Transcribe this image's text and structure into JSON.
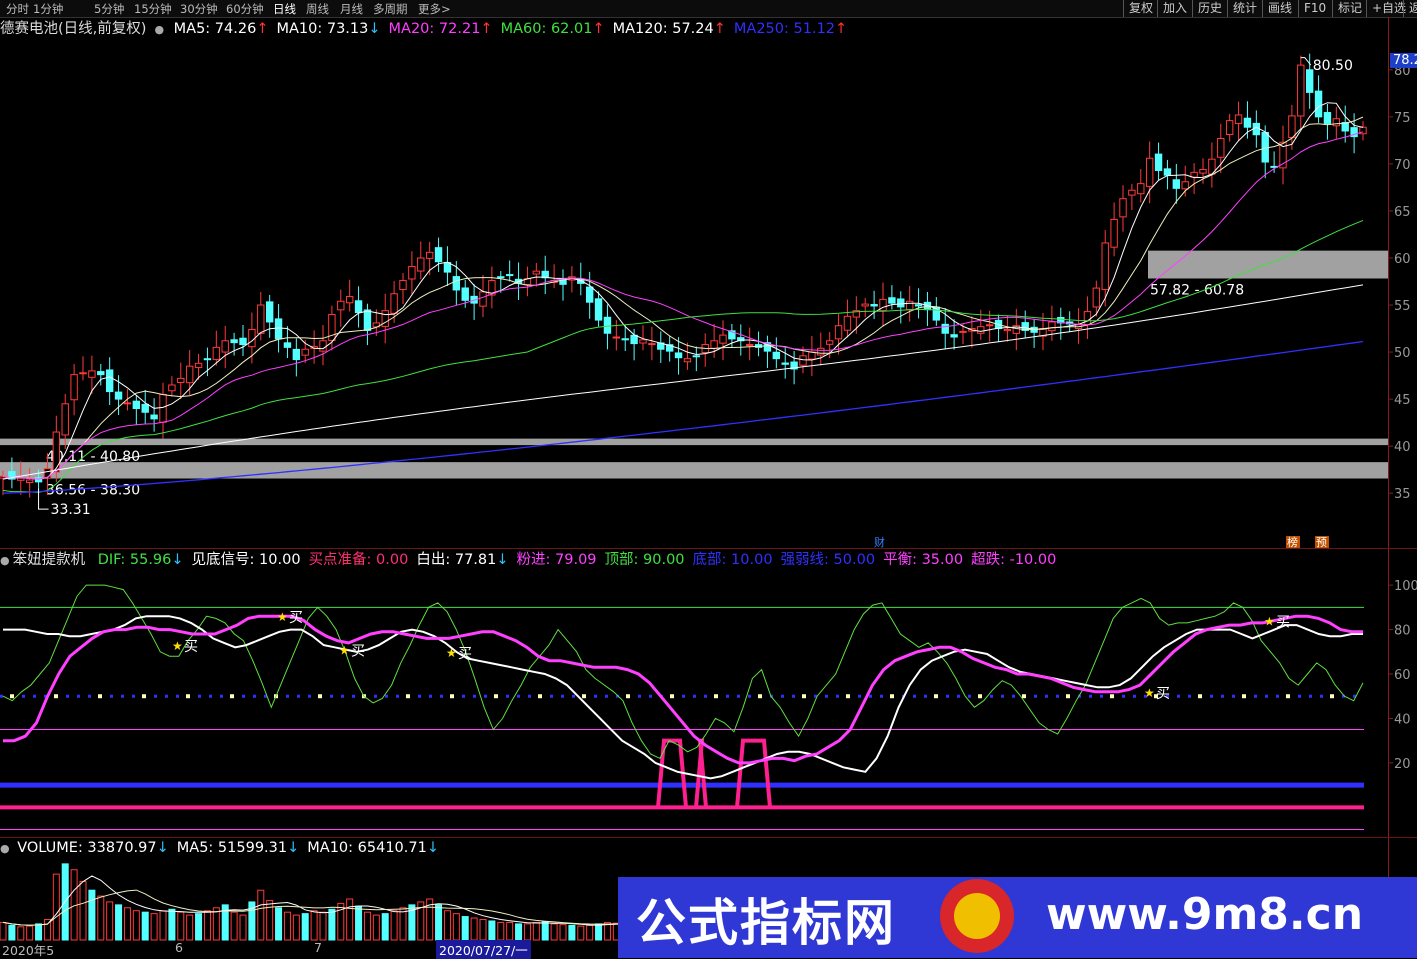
{
  "toolbar": {
    "periods": [
      "分时",
      "1分钟",
      "5分钟",
      "15分钟",
      "30分钟",
      "60分钟",
      "日线",
      "周线",
      "月线",
      "多周期",
      "更多>"
    ],
    "active_period": "日线",
    "right_buttons": [
      "复权",
      "加入",
      "历史",
      "统计",
      "画线",
      "F10",
      "标记",
      "+自选",
      "返"
    ]
  },
  "main_info": {
    "stock": "德赛电池(日线,前复权)",
    "ma": [
      {
        "label": "MA5: 74.26",
        "arrow": "↑",
        "color": "#ffffff"
      },
      {
        "label": "MA10: 73.13",
        "arrow": "↓",
        "color": "#ffffff"
      },
      {
        "label": "MA20: 72.21",
        "arrow": "↑",
        "color": "#ff40ff"
      },
      {
        "label": "MA60: 62.01",
        "arrow": "↑",
        "color": "#40e040"
      },
      {
        "label": "MA120: 57.24",
        "arrow": "↑",
        "color": "#ffffff"
      },
      {
        "label": "MA250: 51.12",
        "arrow": "↑",
        "color": "#3030ff"
      }
    ]
  },
  "indicator_info": {
    "name": "笨妞提款机",
    "items": [
      {
        "label": "DIF: 55.96",
        "arrow": "↓",
        "color": "#40e040"
      },
      {
        "label": "见底信号: 10.00",
        "arrow": "",
        "color": "#ffffff"
      },
      {
        "label": "买点准备: 0.00",
        "arrow": "",
        "color": "#ff3070"
      },
      {
        "label": "白出: 77.81",
        "arrow": "↓",
        "color": "#ffffff"
      },
      {
        "label": "粉进: 79.09",
        "arrow": "",
        "color": "#ff40ff"
      },
      {
        "label": "顶部: 90.00",
        "arrow": "",
        "color": "#40e040"
      },
      {
        "label": "底部: 10.00",
        "arrow": "",
        "color": "#3030ff"
      },
      {
        "label": "强弱线: 50.00",
        "arrow": "",
        "color": "#3030ff"
      },
      {
        "label": "平衡: 35.00",
        "arrow": "",
        "color": "#ff40ff"
      },
      {
        "label": "超跌: -10.00",
        "arrow": "",
        "color": "#ff40ff"
      }
    ]
  },
  "volume_info": {
    "items": [
      {
        "label": "VOLUME: 33870.97",
        "arrow": "↓",
        "color": "#ffffff"
      },
      {
        "label": "MA5: 51599.31",
        "arrow": "↓",
        "color": "#ffffff"
      },
      {
        "label": "MA10: 65410.71",
        "arrow": "↓",
        "color": "#ffffff"
      }
    ]
  },
  "chart_data": [
    {
      "type": "candlestick",
      "title": "德赛电池(日线,前复权)",
      "y_ticks": [
        "80",
        "75",
        "70",
        "65",
        "60",
        "55",
        "50",
        "45",
        "40",
        "35"
      ],
      "ylim": [
        33,
        82
      ],
      "current_price_tag": "78.2",
      "zones": [
        {
          "label": "57.82 - 60.78",
          "low": 57.82,
          "high": 60.78
        },
        {
          "label": "40.11 - 40.80",
          "low": 40.11,
          "high": 40.8
        },
        {
          "label": "36.56 - 38.30",
          "low": 36.56,
          "high": 38.3
        }
      ],
      "annotations": [
        {
          "text": "80.50",
          "value": 80.5
        },
        {
          "text": "33.31",
          "value": 33.31
        }
      ],
      "event_markers": [
        "财",
        "榜",
        "预"
      ],
      "close_path": [
        36.8,
        36.5,
        36.6,
        36.4,
        36.2,
        37.6,
        41.5,
        44.5,
        47.6,
        47.8,
        48.0,
        47.6,
        45.8,
        45.0,
        44.6,
        44.0,
        43.6,
        42.9,
        45.5,
        46.5,
        47.2,
        48.5,
        48.8,
        49.2,
        50.5,
        51.2,
        51.0,
        50.8,
        52.4,
        55.0,
        53.2,
        51.4,
        50.5,
        49.2,
        50.3,
        50.6,
        51.2,
        54.0,
        55.4,
        55.9,
        54.2,
        52.3,
        53.1,
        54.4,
        56.2,
        57.6,
        59.1,
        60.0,
        60.6,
        59.6,
        58.5,
        56.6,
        55.5,
        55.2,
        56.4,
        57.6,
        58.0,
        58.2,
        57.3,
        57.8,
        58.6,
        57.9,
        57.6,
        57.2,
        58.0,
        57.3,
        55.3,
        53.4,
        52.0,
        51.6,
        51.3,
        50.9,
        51.3,
        50.9,
        50.3,
        50.1,
        49.4,
        49.3,
        49.6,
        50.8,
        51.2,
        51.8,
        51.4,
        51.2,
        50.8,
        50.5,
        50.1,
        49.3,
        48.7,
        48.2,
        49.6,
        50.0,
        50.4,
        51.2,
        52.8,
        53.8,
        54.4,
        55.1,
        54.9,
        55.6,
        55.2,
        54.8,
        55.4,
        54.9,
        54.5,
        53.4,
        52.0,
        51.6,
        52.2,
        52.5,
        52.7,
        52.9,
        52.5,
        52.4,
        52.8,
        52.3,
        52.1,
        52.5,
        53.2,
        53.1,
        53.0,
        52.9,
        54.3,
        56.8,
        61.6,
        64.1,
        66.3,
        67.2,
        67.9,
        70.6,
        69.3,
        68.8,
        67.4,
        68.1,
        69.1,
        69.4,
        70.5,
        72.7,
        74.6,
        75.2,
        73.9,
        73.1,
        70.2,
        69.7,
        72.3,
        75.1,
        80.5,
        77.6,
        75.0,
        74.3,
        74.8,
        73.5,
        72.9,
        73.9
      ],
      "ma_series": [
        {
          "name": "MA5",
          "last": 74.26,
          "color": "#ffffff"
        },
        {
          "name": "MA10",
          "last": 73.13,
          "color": "#ffffff"
        },
        {
          "name": "MA20",
          "last": 72.21,
          "color": "#ff40ff"
        },
        {
          "name": "MA60",
          "last": 62.01,
          "color": "#40e040"
        },
        {
          "name": "MA120",
          "last": 57.24,
          "color": "#ffffff"
        },
        {
          "name": "MA250",
          "last": 51.12,
          "color": "#3030ff"
        }
      ]
    },
    {
      "type": "line",
      "title": "笨妞提款机",
      "y_ticks": [
        "100",
        "80",
        "60",
        "40",
        "20"
      ],
      "ylim": [
        -12,
        105
      ],
      "reference_lines": [
        {
          "name": "顶部",
          "value": 90,
          "color": "#40e040",
          "style": "solid"
        },
        {
          "name": "强弱线",
          "value": 50,
          "color": "#3030ff",
          "style": "dotted"
        },
        {
          "name": "平衡",
          "value": 35,
          "color": "#ff40ff",
          "style": "solid"
        },
        {
          "name": "底部",
          "value": 10,
          "color": "#3030ff",
          "style": "thick"
        },
        {
          "name": "超跌",
          "value": -10,
          "color": "#ff40ff",
          "style": "solid"
        }
      ],
      "dif": [
        50,
        48,
        52,
        55,
        60,
        65,
        75,
        85,
        95,
        100,
        100,
        100,
        99,
        98,
        92,
        85,
        78,
        70,
        68,
        68,
        75,
        80,
        86,
        85,
        83,
        78,
        75,
        66,
        56,
        45,
        55,
        65,
        75,
        85,
        90,
        86,
        80,
        70,
        58,
        50,
        47,
        49,
        55,
        65,
        73,
        82,
        90,
        92,
        88,
        80,
        70,
        58,
        45,
        35,
        40,
        48,
        55,
        63,
        68,
        73,
        80,
        75,
        70,
        62,
        58,
        55,
        52,
        48,
        38,
        30,
        24,
        22,
        30,
        28,
        25,
        27,
        33,
        40,
        38,
        34,
        45,
        58,
        62,
        50,
        45,
        38,
        32,
        40,
        50,
        55,
        60,
        70,
        80,
        87,
        91,
        92,
        85,
        78,
        75,
        72,
        74,
        70,
        65,
        58,
        50,
        45,
        48,
        53,
        57,
        55,
        50,
        44,
        38,
        35,
        33,
        40,
        48,
        55,
        65,
        75,
        85,
        90,
        92,
        94,
        92,
        85,
        82,
        83,
        83,
        84,
        85,
        86,
        88,
        92,
        90,
        84,
        75,
        70,
        65,
        58,
        55,
        60,
        65,
        62,
        55,
        50,
        48,
        56
      ],
      "pink_in": [
        30,
        30,
        32,
        38,
        50,
        60,
        68,
        72,
        76,
        79,
        80,
        80,
        81,
        81,
        80,
        80,
        79,
        78,
        78,
        78,
        80,
        82,
        85,
        86,
        86,
        86,
        86,
        84,
        80,
        77,
        75,
        74,
        76,
        78,
        79,
        79,
        78,
        77,
        76,
        76,
        76,
        77,
        78,
        79,
        79,
        77,
        75,
        72,
        68,
        66,
        66,
        65,
        64,
        63,
        63,
        63,
        62,
        60,
        56,
        50,
        44,
        38,
        32,
        28,
        25,
        22,
        20,
        20,
        21,
        22,
        22,
        21,
        23,
        24,
        27,
        30,
        35,
        45,
        55,
        62,
        66,
        68,
        70,
        71,
        72,
        72,
        70,
        67,
        65,
        63,
        62,
        60,
        60,
        59,
        58,
        56,
        54,
        53,
        52,
        52,
        52,
        53,
        55,
        60,
        65,
        70,
        74,
        78,
        80,
        81,
        82,
        82,
        83,
        83,
        84,
        85,
        86,
        86,
        85,
        83,
        80,
        79,
        79
      ],
      "white_out": [
        80,
        80,
        80,
        79,
        78,
        78,
        77,
        77,
        78,
        79,
        80,
        82,
        85,
        86,
        86,
        86,
        85,
        83,
        80,
        76,
        74,
        72,
        73,
        75,
        77,
        79,
        80,
        80,
        77,
        73,
        72,
        71,
        70,
        71,
        73,
        76,
        79,
        80,
        79,
        77,
        74,
        70,
        67,
        66,
        65,
        64,
        63,
        62,
        61,
        60,
        58,
        55,
        50,
        45,
        40,
        35,
        30,
        27,
        24,
        20,
        18,
        16,
        15,
        14,
        13,
        14,
        16,
        18,
        20,
        22,
        24,
        25,
        25,
        24,
        22,
        20,
        18,
        17,
        16,
        22,
        32,
        45,
        55,
        62,
        66,
        68,
        70,
        71,
        70,
        69,
        66,
        63,
        61,
        60,
        59,
        58,
        57,
        56,
        55,
        54,
        54,
        55,
        58,
        63,
        68,
        72,
        75,
        78,
        80,
        80,
        80,
        80,
        78,
        76,
        78,
        80,
        82,
        82,
        80,
        78,
        77,
        77,
        78,
        78
      ],
      "buy_points": [
        {
          "text": "买",
          "value": 73
        },
        {
          "text": "买",
          "value": 86
        },
        {
          "text": "买",
          "value": 71
        },
        {
          "text": "买",
          "value": 70
        },
        {
          "text": "买",
          "value": 52
        },
        {
          "text": "买",
          "value": 84
        }
      ]
    },
    {
      "type": "bar",
      "title": "VOLUME",
      "series": [
        {
          "name": "VOLUME",
          "last": 33870.97
        },
        {
          "name": "MA5",
          "last": 51599.31
        },
        {
          "name": "MA10",
          "last": 65410.71
        }
      ],
      "values": [
        12000,
        10000,
        9000,
        9500,
        11000,
        14000,
        45000,
        52000,
        48000,
        40000,
        34000,
        30000,
        26000,
        24000,
        22000,
        20000,
        19000,
        18000,
        20000,
        21000,
        19000,
        17000,
        18000,
        20000,
        22000,
        24000,
        19000,
        17000,
        26000,
        34000,
        27000,
        22000,
        19000,
        17000,
        18000,
        20000,
        19000,
        21000,
        25000,
        28000,
        23000,
        19000,
        17000,
        18000,
        20000,
        22000,
        24000,
        26000,
        28000,
        24000,
        20000,
        18000,
        16000,
        15000,
        14000,
        13000,
        12000,
        12000,
        11000,
        11000,
        12000,
        12500,
        11000,
        10500,
        10000,
        9500,
        10000,
        11000,
        12000,
        11500,
        11000,
        10500,
        10000,
        9500
      ]
    }
  ],
  "x_axis": {
    "ticks": [
      "2020年5",
      "6",
      "7"
    ],
    "current": "2020/07/27/一"
  },
  "watermark": {
    "title": "公式指标网",
    "url": "www.9m8.cn"
  }
}
